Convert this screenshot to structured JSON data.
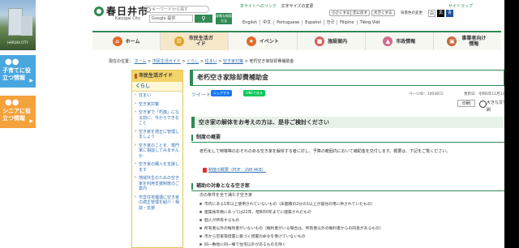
{
  "side": {
    "photo_caption": "HARUHI CITY",
    "box1_label": "子育てに役立つ情報",
    "box2_label": "シニアに役立つ情報"
  },
  "header": {
    "logo_name": "春日井市",
    "logo_sub": "Kasugai City",
    "keyword_placeholder": "キーワードから探す",
    "google_label": "Google 提供",
    "search_label": "検索",
    "kensaku_label": "詳細な検索方法",
    "links": [
      "本サイトへのリンク",
      "文字サイズの変更"
    ],
    "sitemap": "サイトマップ",
    "fontsize_buttons": [
      "小さくする",
      "元に戻す",
      "大きくする"
    ],
    "bg_label": "背景色の変更",
    "bg_buttons": [
      "白",
      "黒",
      "青"
    ],
    "langs": [
      "English",
      "中文",
      "Portuguese",
      "Español",
      "한국",
      "Filipino",
      "Tiếng Việt"
    ]
  },
  "nav": [
    {
      "label": "ホーム",
      "icon": "home-icon",
      "color": "#e06a2a"
    },
    {
      "label": "市民生活ガイド",
      "icon": "guide-icon",
      "color": "#e0a52a",
      "active": true
    },
    {
      "label": "イベント",
      "icon": "event-icon",
      "color": "#e06a2a"
    },
    {
      "label": "施設案内",
      "icon": "facility-icon",
      "color": "#d95d5d"
    },
    {
      "label": "市政情報",
      "icon": "city-info-icon",
      "color": "#d46a8e"
    },
    {
      "label": "事業者向け情報",
      "icon": "business-icon",
      "color": "#c46a3a"
    }
  ],
  "breadcrumb": {
    "prefix": "現在の位置：",
    "items": [
      "ホーム",
      "市民生活ガイド",
      "くらし",
      "住まい",
      "空き家対策",
      "老朽空き家除却費補助金"
    ]
  },
  "leftnav": {
    "header": "市民生活ガイド",
    "current": "くらし",
    "items": [
      "住まい",
      "空き家対策",
      "空き家で「朽廃」になる前に、今からできること",
      "空き家を適正に管理しましょう",
      "空き家のことを、専門家に相談してみませんか",
      "空き家の購入を支援します",
      "地域共生のための空き家を利用支援制度のご案内",
      "市営住宅優遇に空き家の適正管理を紹介・相談・支援"
    ]
  },
  "content": {
    "title": "老朽空き家除却費補助金",
    "tweet": "ツイート",
    "share": "シェアする",
    "line": "LINEで送る",
    "page_id": "ページID：1003872",
    "updated": "更新日：令和6年11月1日",
    "print": "印刷",
    "big_print": "大きな文字で印刷",
    "h2": "空き家の解体をお考えの方は、是非ご検討ください",
    "h3_overview": "制度の概要",
    "overview_text": "老朽化して倒壊等のおそれのある空き家を解体する者に対し、予算の範囲内において補助金を交付します。概要は、下記をご覧ください。",
    "pdf_link": "制度の概要（PDF：298.4KB）",
    "h3_target": "補助の対象となる空き家",
    "target_text": "次の条件を全て満たす空き家",
    "bullets": [
      "市内にある1年以上使用されていないもの（床面積の2分の1以上が居住の用に供されていたもの）",
      "建築後年数にあっては22年、昭和50年までに建築されたもの",
      "個人が所有するもの",
      "所有者以外の権利者がいないもの（権利者がいる場合は、所有者以外の権利者からの同意があるもの）",
      "市から空家等措置に基づく措置の命令を受けていないもの",
      "同一敷地に同一棟で住宅以外があるものを除く"
    ]
  }
}
